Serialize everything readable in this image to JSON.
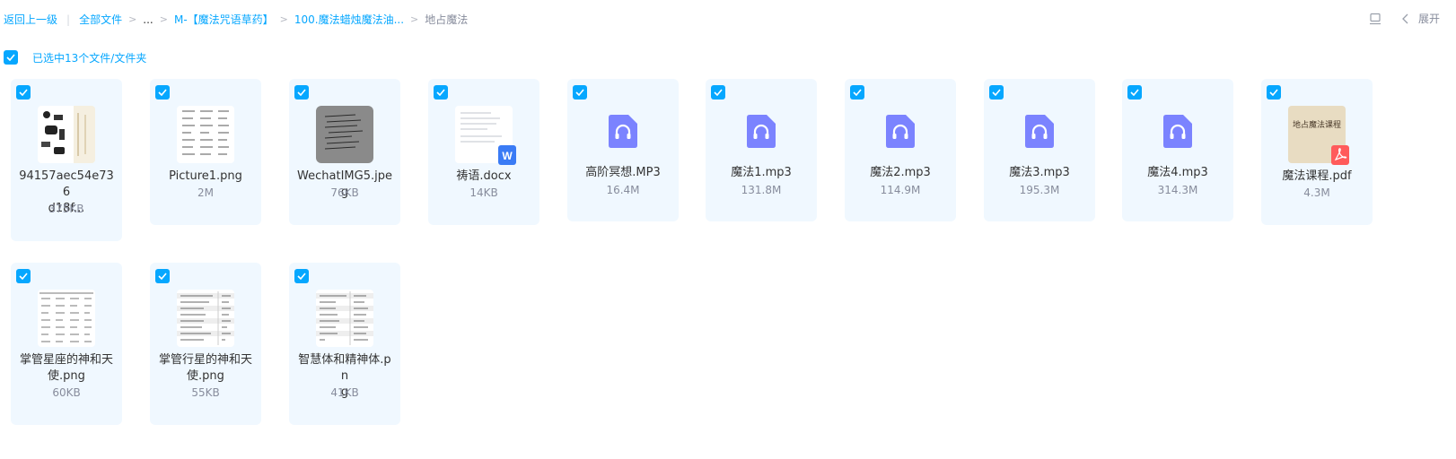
{
  "breadcrumb": {
    "back": "返回上一级",
    "all_files": "全部文件",
    "ellipsis": "...",
    "level1": "M-【魔法咒语草药】",
    "level2": "100.魔法蜡烛魔法油...",
    "current": "地占魔法"
  },
  "toolbar": {
    "expand_label": "展开"
  },
  "selection": {
    "text": "已选中13个文件/文件夹"
  },
  "colors": {
    "accent": "#06a7ff",
    "audio": "#7b83ff",
    "word": "#3a7bf5",
    "pdf": "#ff5b5b"
  },
  "files": [
    {
      "name_line1": "94157aec54e736",
      "name_line2": "d18f...",
      "size": "375KB",
      "icon": "image-thumb"
    },
    {
      "name_line1": "Picture1.png",
      "name_line2": "",
      "size": "2M",
      "icon": "image-thumb"
    },
    {
      "name_line1": "WechatIMG5.jpeg",
      "name_line2": "",
      "size": "76KB",
      "icon": "image-thumb"
    },
    {
      "name_line1": "祷语.docx",
      "name_line2": "",
      "size": "14KB",
      "icon": "word-doc"
    },
    {
      "name_line1": "高阶冥想.MP3",
      "name_line2": "",
      "size": "16.4M",
      "icon": "audio-headphones"
    },
    {
      "name_line1": "魔法1.mp3",
      "name_line2": "",
      "size": "131.8M",
      "icon": "audio-headphones"
    },
    {
      "name_line1": "魔法2.mp3",
      "name_line2": "",
      "size": "114.9M",
      "icon": "audio-headphones"
    },
    {
      "name_line1": "魔法3.mp3",
      "name_line2": "",
      "size": "195.3M",
      "icon": "audio-headphones"
    },
    {
      "name_line1": "魔法4.mp3",
      "name_line2": "",
      "size": "314.3M",
      "icon": "audio-headphones"
    },
    {
      "name_line1": "魔法课程.pdf",
      "name_line2": "",
      "size": "4.3M",
      "icon": "pdf-doc",
      "thumb_text": "地占魔法课程"
    },
    {
      "name_line1": "掌管星座的神和天",
      "name_line2": "使.png",
      "size": "60KB",
      "icon": "image-thumb"
    },
    {
      "name_line1": "掌管行星的神和天",
      "name_line2": "使.png",
      "size": "55KB",
      "icon": "image-thumb"
    },
    {
      "name_line1": "智慧体和精神体.pn",
      "name_line2": "g",
      "size": "41KB",
      "icon": "image-thumb"
    }
  ]
}
